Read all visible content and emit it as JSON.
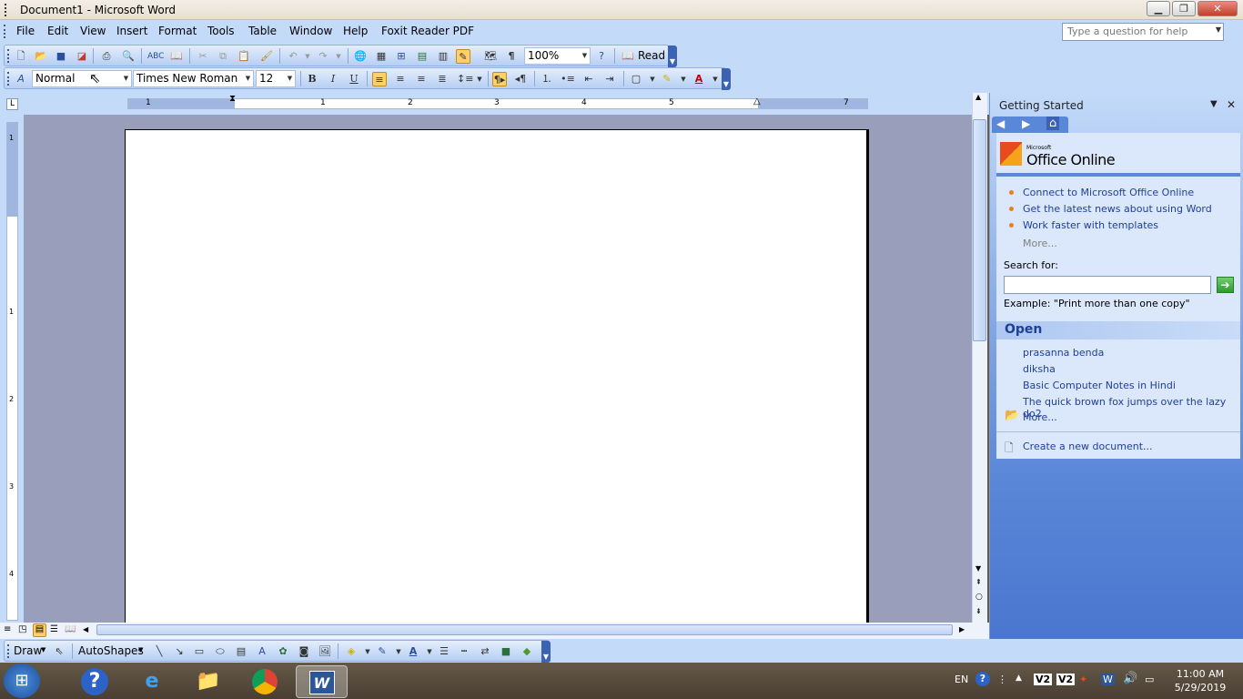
{
  "window": {
    "title": "Document1 - Microsoft Word",
    "min_icon": "minimize-icon",
    "max_icon": "maximize-icon",
    "close_icon": "close-icon"
  },
  "menu": [
    "File",
    "Edit",
    "View",
    "Insert",
    "Format",
    "Tools",
    "Table",
    "Window",
    "Help",
    "Foxit Reader PDF"
  ],
  "ask_box": {
    "placeholder": "Type a question for help"
  },
  "standard_toolbar": {
    "zoom": "100%",
    "read_label": "Read"
  },
  "formatting_toolbar": {
    "style": "Normal",
    "font": "Times New Roman",
    "size": "12",
    "bold": "B",
    "italic": "I",
    "underline": "U"
  },
  "ruler": {
    "h_marks": [
      "1",
      "1",
      "2",
      "3",
      "4",
      "5",
      "7"
    ],
    "v_marks": [
      "1",
      "1",
      "2",
      "3",
      "4"
    ]
  },
  "task_pane": {
    "title": "Getting Started",
    "logo_small": "Microsoft",
    "logo_big": "Office Online",
    "links": [
      "Connect to Microsoft Office Online",
      "Get the latest news about using Word",
      "Work faster with templates"
    ],
    "more": "More...",
    "search_label": "Search for:",
    "example": "Example:  \"Print more than one copy\"",
    "open_header": "Open",
    "recent": [
      "prasanna benda",
      "diksha",
      "Basic Computer Notes in Hindi",
      "The quick brown fox jumps over the lazy do2"
    ],
    "open_more": "More...",
    "create_new": "Create a new document..."
  },
  "draw_toolbar": {
    "draw_label": "Draw",
    "autoshapes_label": "AutoShapes"
  },
  "taskbar": {
    "lang": "EN",
    "time": "11:00 AM",
    "date": "5/29/2019"
  },
  "colors": {
    "office_blue": "#c3daf9",
    "task_pane_dark": "#4a76cf",
    "link_blue": "#1f3f9a",
    "bullet_orange": "#e8801c"
  }
}
